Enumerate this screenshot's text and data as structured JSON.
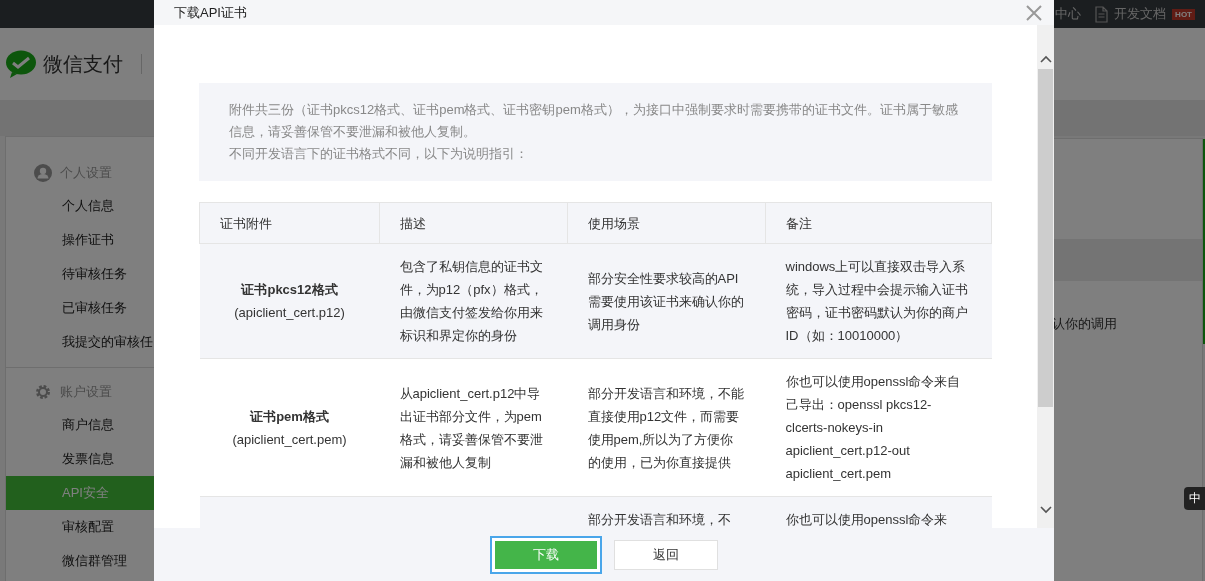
{
  "topbar": {
    "items": [
      {
        "kind": "link",
        "label": "中心"
      },
      {
        "kind": "doc",
        "label": "开发文档",
        "badge": "HOT"
      }
    ]
  },
  "header": {
    "brand": "微信支付"
  },
  "sidebar": {
    "groups": [
      {
        "kind": "person",
        "title": "个人设置",
        "items": [
          {
            "label": "个人信息",
            "selected": false
          },
          {
            "label": "操作证书",
            "selected": false
          },
          {
            "label": "待审核任务",
            "selected": false
          },
          {
            "label": "已审核任务",
            "selected": false
          },
          {
            "label": "我提交的审核任",
            "selected": false
          }
        ]
      },
      {
        "kind": "gear",
        "title": "账户设置",
        "items": [
          {
            "label": "商户信息",
            "selected": false
          },
          {
            "label": "发票信息",
            "selected": false
          },
          {
            "label": "API安全",
            "selected": true
          },
          {
            "label": "审核配置",
            "selected": false
          },
          {
            "label": "微信群管理",
            "selected": false
          }
        ]
      }
    ]
  },
  "background_text": "认你的调用",
  "ime_badge": "中",
  "dialog": {
    "title": "下载API证书",
    "notice": [
      "附件共三份（证书pkcs12格式、证书pem格式、证书密钥pem格式），为接口中强制要求时需要携带的证书文件。证书属于敏感信息，请妥善保管不要泄漏和被他人复制。",
      "不同开发语言下的证书格式不同，以下为说明指引："
    ],
    "table": {
      "columns": [
        "证书附件",
        "描述",
        "使用场景",
        "备注"
      ],
      "rows": [
        {
          "name": "证书pkcs12格式",
          "file": "(apiclient_cert.p12)",
          "description": "包含了私钥信息的证书文件，为p12（pfx）格式，由微信支付签发给你用来标识和界定你的身份",
          "usage": "部分安全性要求较高的API需要使用该证书来确认你的调用身份",
          "note": "windows上可以直接双击导入系统，导入过程中会提示输入证书密码，证书密码默认为你的商户ID（如：10010000）"
        },
        {
          "name": "证书pem格式",
          "file": "(apiclient_cert.pem)",
          "description": "从apiclient_cert.p12中导出证书部分文件，为pem格式，请妥善保管不要泄漏和被他人复制",
          "usage": "部分开发语言和环境，不能直接使用p12文件，而需要使用pem,所以为了方便你的使用，已为你直接提供",
          "note": "你也可以使用openssl命令来自己导出：openssl pkcs12-clcerts-nokeys-in apiclient_cert.p12-out apiclient_cert.pem"
        },
        {
          "usage": "部分开发语言和环境，不",
          "note": "你也可以使用openssl命令来"
        }
      ]
    },
    "buttons": [
      {
        "kind": "primary",
        "label": "下载",
        "focused": true
      },
      {
        "kind": "secondary",
        "label": "返回",
        "focused": false
      }
    ]
  }
}
